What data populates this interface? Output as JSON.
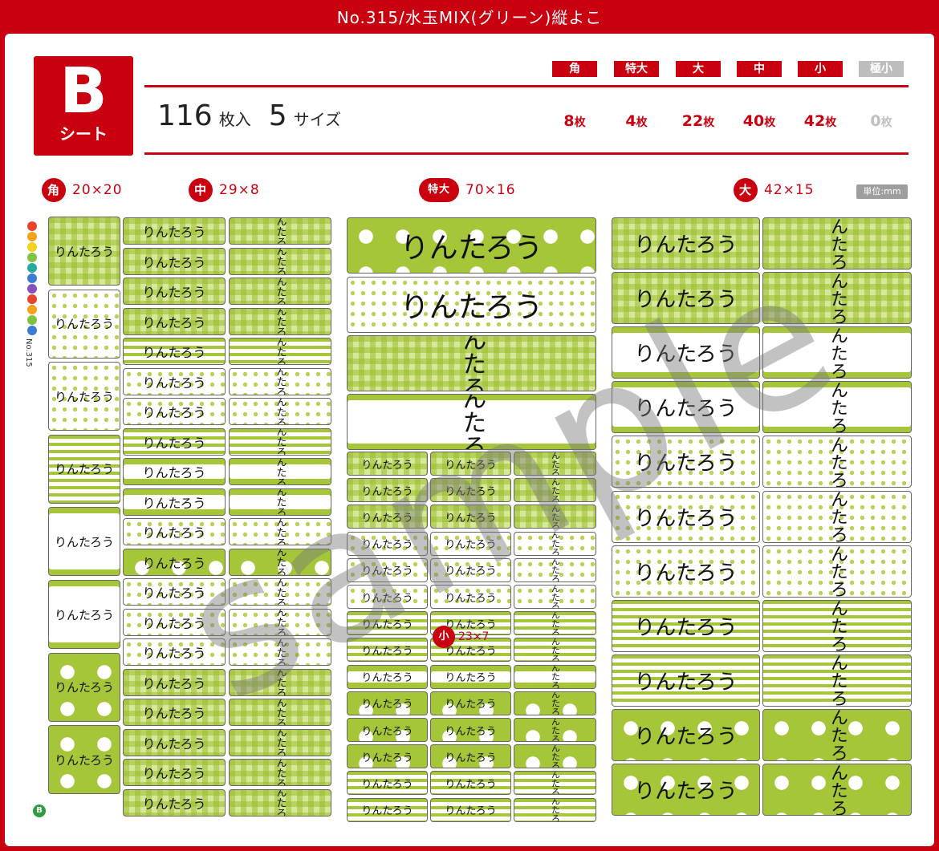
{
  "header": {
    "title": "No.315/水玉MIX(グリーン)縦よこ"
  },
  "sheet": {
    "letter": "B",
    "sheet_label": "シート"
  },
  "summary": {
    "count": "116",
    "count_unit": "枚入",
    "sizes": "5",
    "sizes_unit": "サイズ"
  },
  "sizes": [
    {
      "tag": "角",
      "count": "8",
      "unit": "枚"
    },
    {
      "tag": "特大",
      "count": "4",
      "unit": "枚"
    },
    {
      "tag": "大",
      "count": "22",
      "unit": "枚"
    },
    {
      "tag": "中",
      "count": "40",
      "unit": "枚"
    },
    {
      "tag": "小",
      "count": "42",
      "unit": "枚"
    },
    {
      "tag": "極小",
      "count": "0",
      "unit": "枚"
    }
  ],
  "sections": {
    "kaku": {
      "tag": "角",
      "dims": "20×20"
    },
    "chu": {
      "tag": "中",
      "dims": "29×8"
    },
    "tokudai": {
      "tag": "特大",
      "dims": "70×16"
    },
    "dai": {
      "tag": "大",
      "dims": "42×15"
    },
    "sho": {
      "tag": "小",
      "dims": "23×7"
    }
  },
  "unit_label": "単位:mm",
  "brand": {
    "side_no": "No.315",
    "mark": "B"
  },
  "name": "りんたろう",
  "watermark": "sample",
  "colors": {
    "accent": "#c8000f",
    "green": "#a6c63a"
  }
}
